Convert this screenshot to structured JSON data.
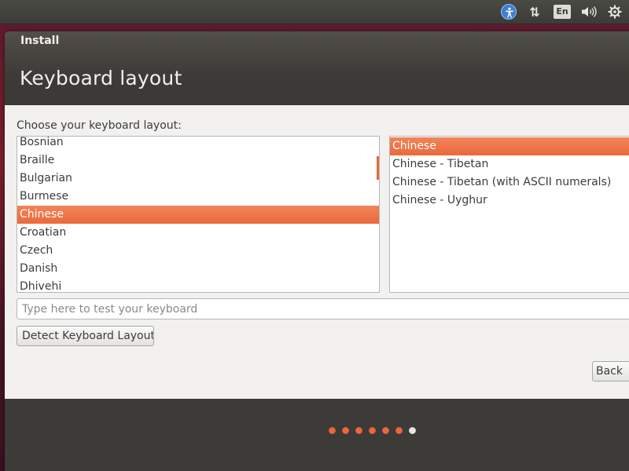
{
  "panel": {
    "indicators": [
      "accessibility-icon",
      "network-icon",
      "keyboard-language",
      "volume-icon",
      "settings-gear-icon"
    ],
    "language_label": "En",
    "network_glyph": "⇅"
  },
  "window": {
    "title": "Install",
    "heading": "Keyboard layout"
  },
  "main": {
    "prompt": "Choose your keyboard layout:",
    "layouts": [
      {
        "label": "Bosnian",
        "selected": false
      },
      {
        "label": "Braille",
        "selected": false
      },
      {
        "label": "Bulgarian",
        "selected": false
      },
      {
        "label": "Burmese",
        "selected": false
      },
      {
        "label": "Chinese",
        "selected": true
      },
      {
        "label": "Croatian",
        "selected": false
      },
      {
        "label": "Czech",
        "selected": false
      },
      {
        "label": "Danish",
        "selected": false
      },
      {
        "label": "Dhivehi",
        "selected": false
      }
    ],
    "variants": [
      {
        "label": "Chinese",
        "selected": true
      },
      {
        "label": "Chinese - Tibetan",
        "selected": false
      },
      {
        "label": "Chinese - Tibetan (with ASCII numerals)",
        "selected": false
      },
      {
        "label": "Chinese - Uyghur",
        "selected": false
      }
    ],
    "test_placeholder": "Type here to test your keyboard",
    "test_value": "",
    "detect_button": "Detect Keyboard Layout",
    "back_button": "Back"
  },
  "progress": {
    "total_steps": 7,
    "current_step": 7
  },
  "colors": {
    "accent": "#e9693c",
    "panel": "#3c3b37",
    "window_bg": "#f2f1f0"
  }
}
